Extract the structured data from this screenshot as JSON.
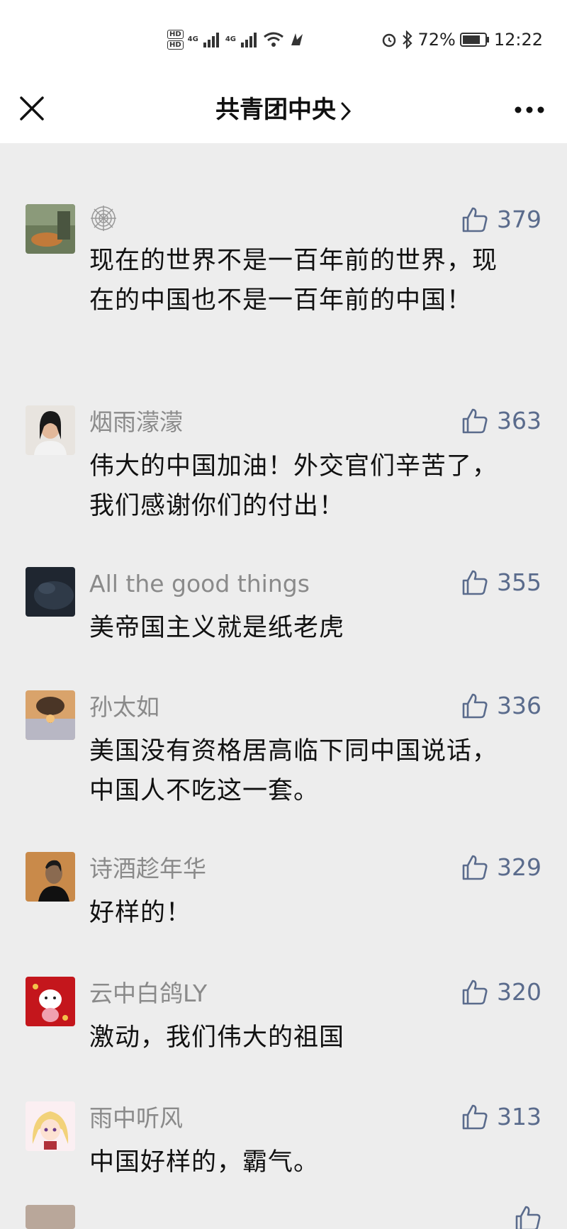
{
  "status_bar": {
    "network": "4G",
    "battery": "72%",
    "time": "12:22"
  },
  "nav": {
    "title": "共青团中央"
  },
  "comments": [
    {
      "nickname": "",
      "likes": "379",
      "text": "现在的世界不是一百年前的世界，现在的中国也不是一百年前的中国！"
    },
    {
      "nickname": "烟雨濛濛",
      "likes": "363",
      "text": "伟大的中国加油！外交官们辛苦了，我们感谢你们的付出！"
    },
    {
      "nickname": "All the good things",
      "likes": "355",
      "text": "美帝国主义就是纸老虎"
    },
    {
      "nickname": "孙太如",
      "likes": "336",
      "text": "美国没有资格居高临下同中国说话，中国人不吃这一套。"
    },
    {
      "nickname": "诗酒趁年华",
      "likes": "329",
      "text": "好样的！"
    },
    {
      "nickname": "云中白鸽LY",
      "likes": "320",
      "text": "激动，我们伟大的祖国"
    },
    {
      "nickname": "雨中听风",
      "likes": "313",
      "text": "中国好样的，霸气。"
    }
  ],
  "colors": {
    "background": "#ededed",
    "nickname": "#8a8a8a",
    "like": "#5a6b8c"
  }
}
